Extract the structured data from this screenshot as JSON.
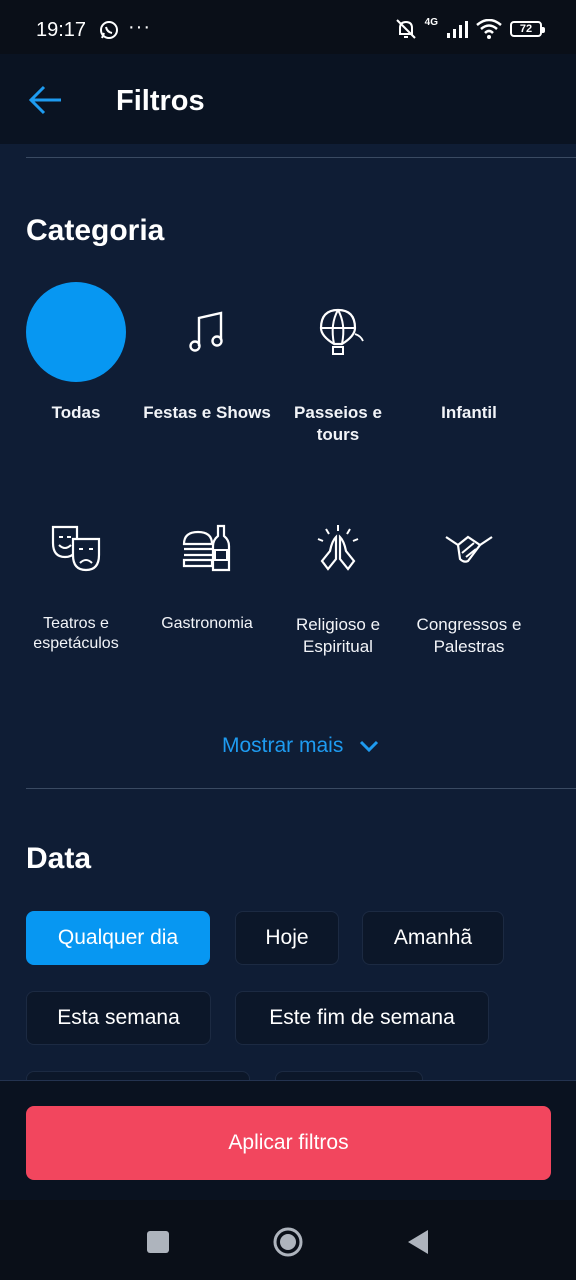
{
  "status_bar": {
    "time": "19:17",
    "dots": "···",
    "network": "4G",
    "battery": "72"
  },
  "header": {
    "title": "Filtros"
  },
  "categoria": {
    "title": "Categoria",
    "items": [
      {
        "label": "Todas",
        "icon": "selected-circle"
      },
      {
        "label": "Festas e Shows",
        "icon": "music-note-icon"
      },
      {
        "label": "Passeios e tours",
        "icon": "hot-air-balloon-icon"
      },
      {
        "label": "Infantil",
        "icon": "none"
      },
      {
        "label": "Teatros e espetáculos",
        "icon": "theater-masks-icon"
      },
      {
        "label": "Gastronomia",
        "icon": "burger-bottle-icon"
      },
      {
        "label": "Religioso e Espiritual",
        "icon": "praying-hands-icon"
      },
      {
        "label": "Congressos e Palestras",
        "icon": "handshake-icon"
      }
    ],
    "show_more": "Mostrar mais"
  },
  "data": {
    "title": "Data",
    "options": [
      {
        "label": "Qualquer dia",
        "selected": true
      },
      {
        "label": "Hoje",
        "selected": false
      },
      {
        "label": "Amanhã",
        "selected": false
      },
      {
        "label": "Esta semana",
        "selected": false
      },
      {
        "label": "Este fim de semana",
        "selected": false
      }
    ]
  },
  "footer": {
    "apply_label": "Aplicar filtros"
  },
  "colors": {
    "accent": "#0797f2",
    "apply": "#f2465e",
    "background": "#0f1d35"
  }
}
